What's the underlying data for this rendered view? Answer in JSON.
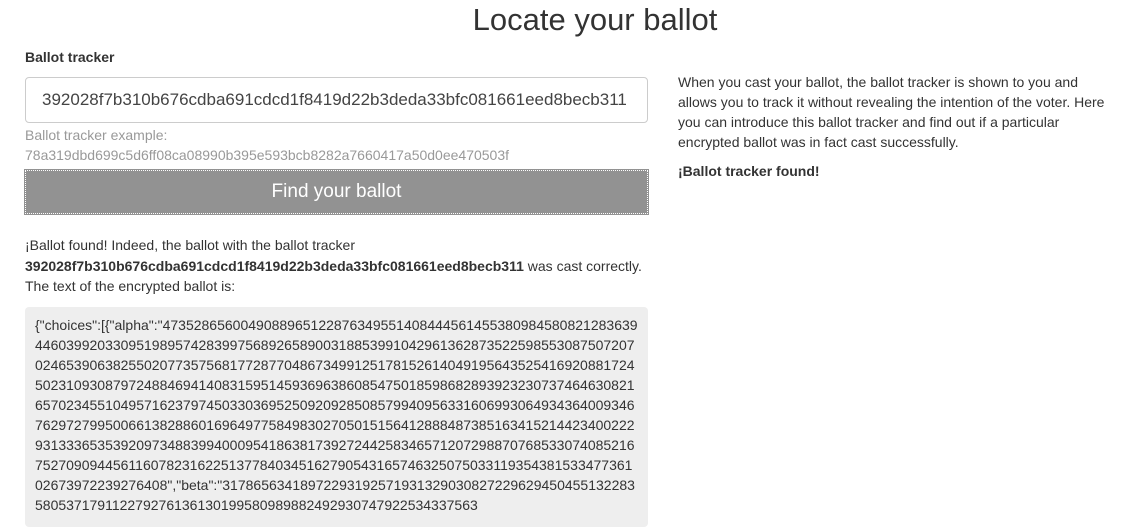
{
  "page_title": "Locate your ballot",
  "tracker_label": "Ballot tracker",
  "tracker_value": "392028f7b310b676cdba691cdcd1f8419d22b3deda33bfc081661eed8becb311",
  "example_label": "Ballot tracker example:",
  "example_value": "78a319dbd699c5d6ff08ca08990b395e593bcb8282a7660417a50d0ee470503f",
  "find_button": "Find your ballot",
  "result": {
    "prefix": "¡Ballot found! Indeed, the ballot with the ballot tracker ",
    "tracker": "392028f7b310b676cdba691cdcd1f8419d22b3deda33bfc081661eed8becb311",
    "suffix": " was cast correctly. The text of the encrypted ballot is:"
  },
  "encrypted_ballot": "{\"choices\":[{\"alpha\":\"47352865600490889651228763495514084445614553809845808212836394460399203309519895742839975689265890031885399104296136287352259855308750720702465390638255020773575681772877048673499125178152614049195643525416920881724502310930879724884694140831595145936963860854750185986828939232307374646308216570234551049571623797450330369525092092850857994095633160699306493436400934676297279950066138288601696497758498302705015156412888487385163415214423400222931333653539209734883994000954186381739272442583465712072988707685330740852167527090944561160782316225137784034516279054316574632507503311935438153347736102673972239276408\",\"beta\":\"31786563418972293192571931329030827229629450455132283580537179112279276136130199580989882492930747922534337563",
  "info_text": "When you cast your ballot, the ballot tracker is shown to you and allows you to track it without revealing the intention of the voter. Here you can introduce this ballot tracker and find out if a particular encrypted ballot was in fact cast successfully.",
  "status": "¡Ballot tracker found!"
}
